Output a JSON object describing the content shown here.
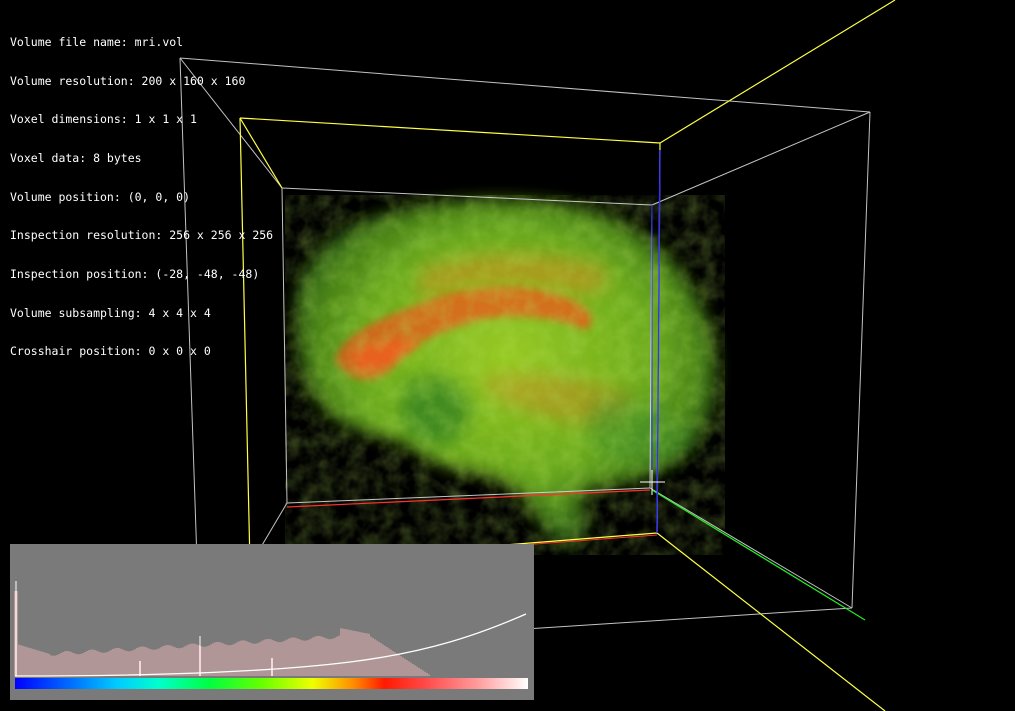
{
  "info_lines": [
    "Volume file name: mri.vol",
    "Volume resolution: 200 x 160 x 160",
    "Voxel dimensions: 1 x 1 x 1",
    "Voxel data: 8 bytes",
    "Volume position: (0, 0, 0)",
    "Inspection resolution: 256 x 256 x 256",
    "Inspection position: (-28, -48, -48)",
    "Volume subsampling: 4 x 4 x 4",
    "Crosshair position: 0 x 0 x 0"
  ],
  "colors": {
    "background": "#000000",
    "inspection_box": "#ffff44",
    "volume_box": "#d8d8d8",
    "axis_x": "#ff3030",
    "axis_y": "#22ee22",
    "axis_z": "#3030ff",
    "crosshair": "#ffffff",
    "panel_bg": "#7a7a7a",
    "histogram": "#e6b3b3",
    "opacity_curve": "#ffffff"
  },
  "transfer_function": {
    "colormap": [
      "#0000ff",
      "#00aaff",
      "#00ffff",
      "#00ff80",
      "#00ff00",
      "#aaff00",
      "#ffff00",
      "#ff8000",
      "#ff0000",
      "#ff6060",
      "#ffa0a0",
      "#ffffff"
    ]
  }
}
